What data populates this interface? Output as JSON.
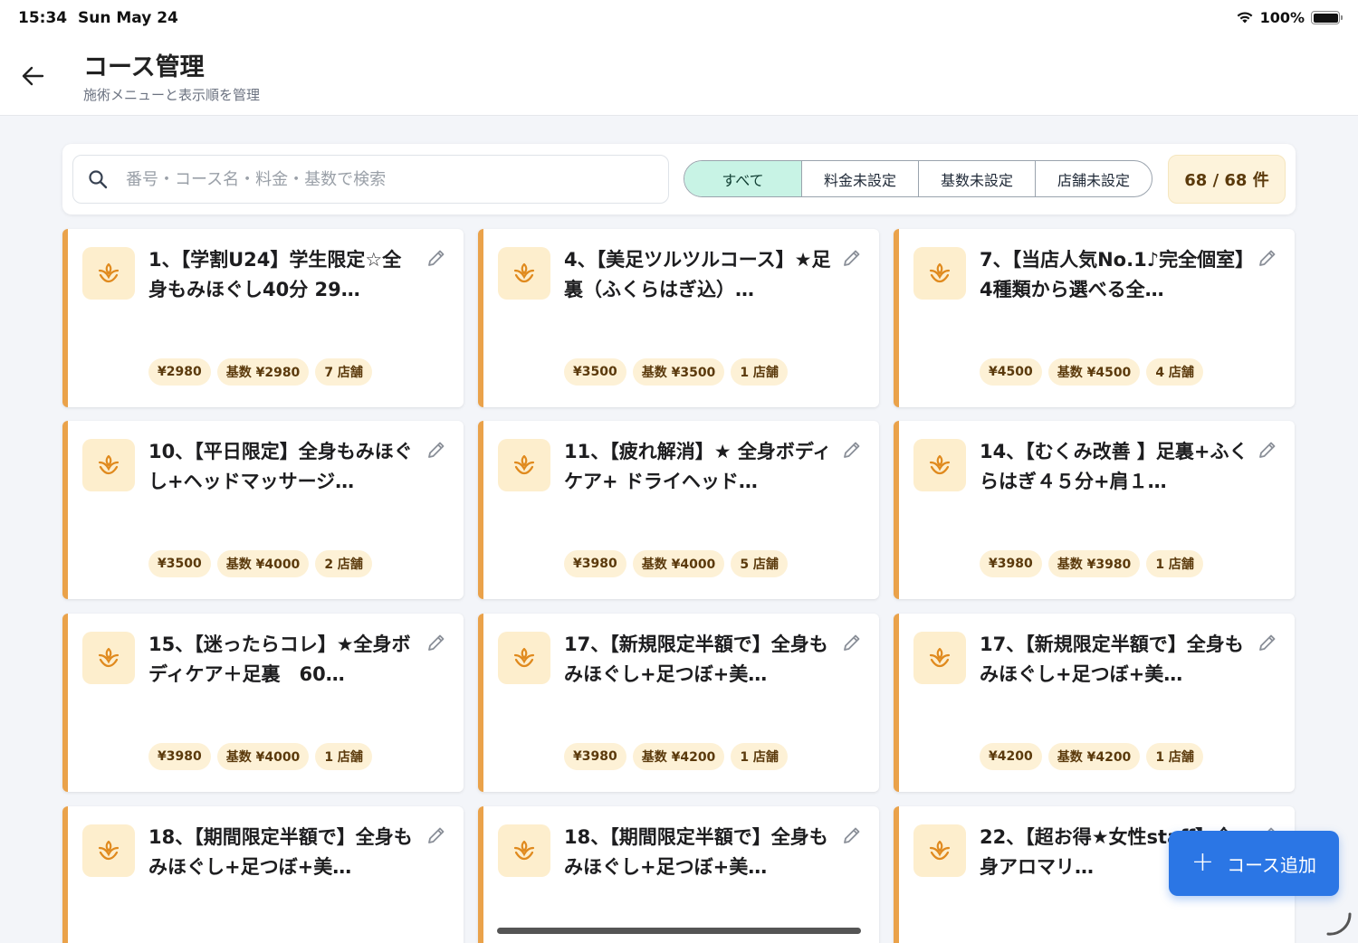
{
  "status_bar": {
    "time": "15:34",
    "date": "Sun May 24",
    "battery": "100%",
    "battery_level": 1.0
  },
  "header": {
    "title": "コース管理",
    "subtitle": "施術メニューと表示順を管理"
  },
  "search": {
    "placeholder": "番号・コース名・料金・基数で検索",
    "value": ""
  },
  "filters": [
    {
      "label": "すべて",
      "active": true
    },
    {
      "label": "料金未設定",
      "active": false
    },
    {
      "label": "基数未設定",
      "active": false
    },
    {
      "label": "店舗未設定",
      "active": false
    }
  ],
  "count": "68 / 68 件",
  "accent_color": "#eaa24a",
  "courses": [
    {
      "title": "1、【学割U24】学生限定☆全身もみほぐし40分 29…",
      "price": "¥2980",
      "base": "基数 ¥2980",
      "stores": "7 店舗"
    },
    {
      "title": "4、【美足ツルツルコース】★足裏（ふくらはぎ込）…",
      "price": "¥3500",
      "base": "基数 ¥3500",
      "stores": "1 店舗"
    },
    {
      "title": "7、【当店人気No.1♪完全個室】4種類から選べる全…",
      "price": "¥4500",
      "base": "基数 ¥4500",
      "stores": "4 店舗"
    },
    {
      "title": "10、【平日限定】全身もみほぐし+ヘッドマッサージ…",
      "price": "¥3500",
      "base": "基数 ¥4000",
      "stores": "2 店舗"
    },
    {
      "title": "11、【疲れ解消】★ 全身ボディケア+ ドライヘッド…",
      "price": "¥3980",
      "base": "基数 ¥4000",
      "stores": "5 店舗"
    },
    {
      "title": "14、【むくみ改善 】足裏+ふくらはぎ４５分+肩１…",
      "price": "¥3980",
      "base": "基数 ¥3980",
      "stores": "1 店舗"
    },
    {
      "title": "15、【迷ったらコレ】★全身ボディケア＋足裏　60…",
      "price": "¥3980",
      "base": "基数 ¥4000",
      "stores": "1 店舗"
    },
    {
      "title": "17、【新規限定半額で】全身もみほぐし+足つぼ+美…",
      "price": "¥3980",
      "base": "基数 ¥4200",
      "stores": "1 店舗"
    },
    {
      "title": "17、【新規限定半額で】全身もみほぐし+足つぼ+美…",
      "price": "¥4200",
      "base": "基数 ¥4200",
      "stores": "1 店舗"
    },
    {
      "title": "18、【期間限定半額で】全身もみほぐし+足つぼ+美…",
      "price": "",
      "base": "",
      "stores": ""
    },
    {
      "title": "18、【期間限定半額で】全身もみほぐし+足つぼ+美…",
      "price": "",
      "base": "",
      "stores": ""
    },
    {
      "title": "22、【超お得★女性staff】全身アロマリ…",
      "price": "",
      "base": "",
      "stores": ""
    }
  ],
  "fab": {
    "label": "コース追加",
    "icon": "plus-icon"
  }
}
